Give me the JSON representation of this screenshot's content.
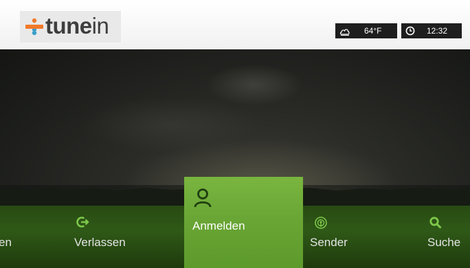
{
  "header": {
    "logo": {
      "text_bold": "tune",
      "text_light": "in"
    },
    "weather": {
      "icon": "weather-cloud-icon",
      "temperature": "64°F"
    },
    "clock": {
      "icon": "clock-icon",
      "time": "12:32"
    }
  },
  "menu": {
    "items": [
      {
        "label": "en",
        "icon": ""
      },
      {
        "label": "Verlassen",
        "icon": "exit-icon"
      },
      {
        "label": "Anmelden",
        "icon": "user-icon",
        "selected": true
      },
      {
        "label": "Sender",
        "icon": "station-icon"
      },
      {
        "label": "Suche",
        "icon": "search-icon"
      }
    ]
  },
  "colors": {
    "accent": "#6aa635",
    "menu_bar": "#2f5917",
    "header_bg": "#ffffff"
  }
}
